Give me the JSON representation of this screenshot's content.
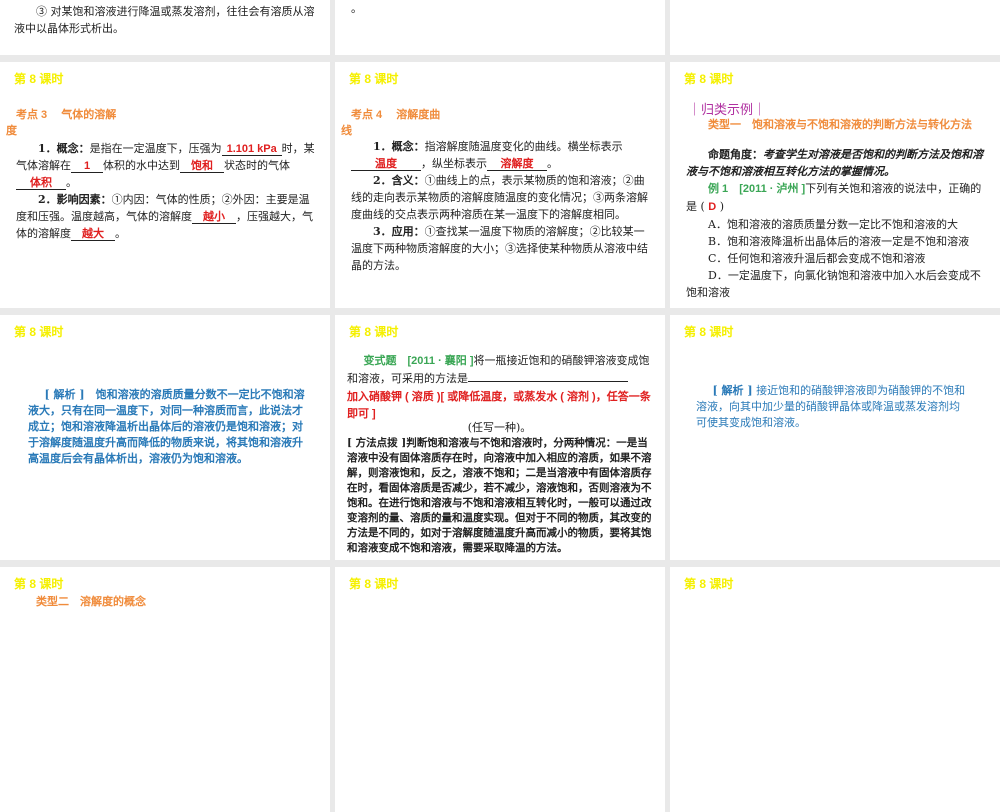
{
  "lesson": "第 8 课时",
  "p0": {
    "text": "③ 对某饱和溶液进行降温或蒸发溶剂，往往会有溶质从溶液中以晶体形式析出。"
  },
  "p1": {
    "heading": "考点 3　 气体的溶解度",
    "l1a": "1．概念：",
    "l1b": "是指在一定温度下，压强为",
    "a1": "1.101 kPa",
    "l1c": "时，某气体溶解在",
    "a2": "1",
    "l1d": "体积的水中达到",
    "a3": "饱和",
    "l1e": "状态时的气体",
    "a4": "体积",
    "l1f": "。",
    "l2a": "2．影响因素：",
    "l2b": "①内因：气体的性质；②外因：主要是温度和压强。温度越高，气体的溶解度",
    "a5": "越小",
    "l2c": "，压强越大，气体的溶解度",
    "a6": "越大",
    "l2d": "。"
  },
  "p2": {
    "heading": "考点 4　 溶解度曲线",
    "l1a": "1．概念：",
    "l1b": "指溶解度随温度变化的曲线。横坐标表示",
    "a1": "温度",
    "l1c": "，纵坐标表示",
    "a2": "溶解度",
    "l1d": "。",
    "l2a": "2．含义：",
    "l2b": "①曲线上的点，表示某物质的饱和溶液；②曲线的走向表示某物质的溶解度随温度的变化情况；③两条溶解度曲线的交点表示两种溶质在某一温度下的溶解度相同。",
    "l3a": "3．应用：",
    "l3b": "①查找某一温度下物质的溶解度；②比较某一温度下两种物质溶解度的大小；③选择使某种物质从溶液中结晶的方法。"
  },
  "p3": {
    "section": "｜归类示例｜",
    "type": "类型一　饱和溶液与不饱和溶液的判断方法与转化方法",
    "angle_label": "命题角度：",
    "angle": "考查学生对溶液是否饱和的判断方法及饱和溶液与不饱和溶液相互转化方法的掌握情况。",
    "ex": "例 1",
    "src": "[2011 · 泸州 ]",
    "q": "下列有关饱和溶液的说法中，正确的是 (",
    "ans": "D",
    "close": ")",
    "options": [
      "A．饱和溶液的溶质质量分数一定比不饱和溶液的大",
      "B．饱和溶液降温析出晶体后的溶液一定是不饱和溶液",
      "C．任何饱和溶液升温后都会变成不饱和溶液",
      "D．一定温度下，向氯化钠饱和溶液中加入水后会变成不饱和溶液"
    ]
  },
  "p4": {
    "label": "[ 解析 ]",
    "text": "饱和溶液的溶质质量分数不一定比不饱和溶液大，只有在同一温度下，对同一种溶质而言，此说法才成立；饱和溶液降温析出晶体后的溶液仍是饱和溶液；对于溶解度随温度升高而降低的物质来说，将其饱和溶液升高温度后会有晶体析出，溶液仍为饱和溶液。"
  },
  "p5": {
    "label": "变式题",
    "src": "[2011 · 襄阳 ]",
    "q": "将一瓶接近饱和的硝酸钾溶液变成饱和溶液，可采用的方法是",
    "ans": "加入硝酸钾 ( 溶质 )[ 或降低温度，或蒸发水 ( 溶剂 )，任答一条即可 ]",
    "tail": "(任写一种)。",
    "tip_label": "[ 方法点拨 ]",
    "tip": "判断饱和溶液与不饱和溶液时，分两种情况：一是当溶液中没有固体溶质存在时，向溶液中加入相应的溶质，如果不溶解，则溶液饱和，反之，溶液不饱和；二是当溶液中有固体溶质存在时，看固体溶质是否减少，若不减少，溶液饱和，否则溶液为不饱和。在进行饱和溶液与不饱和溶液相互转化时，一般可以通过改变溶剂的量、溶质的量和温度实现。但对于不同的物质，其改变的方法是不同的，如对于溶解度随温度升高而减小的物质，要将其饱和溶液变成不饱和溶液，需要采取降温的方法。"
  },
  "p6": {
    "label": "[ 解析 ]",
    "text": "接近饱和的硝酸钾溶液即为硝酸钾的不饱和溶液，向其中加少量的硝酸钾晶体或降温或蒸发溶剂均可使其变成饱和溶液。"
  },
  "p9": {
    "type": "类型二　溶解度的概念"
  }
}
